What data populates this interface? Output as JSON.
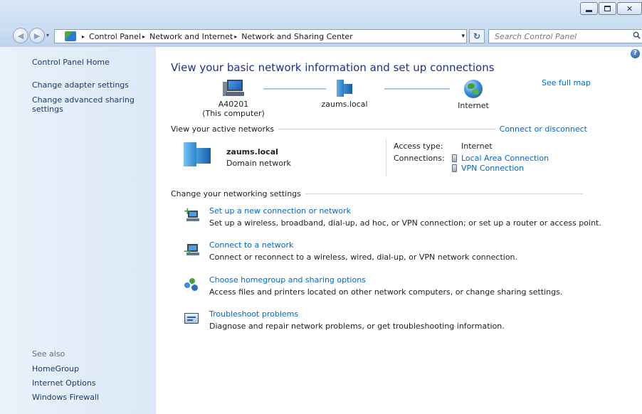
{
  "window": {
    "minimize_glyph": "",
    "close_glyph": "✕"
  },
  "address_bar": {
    "crumbs": [
      "Control Panel",
      "Network and Internet",
      "Network and Sharing Center"
    ],
    "arrow": "▸",
    "dropdown": "▾",
    "refresh": "↻"
  },
  "search": {
    "placeholder": "Search Control Panel"
  },
  "left_pane": {
    "home": "Control Panel Home",
    "adapter": "Change adapter settings",
    "advanced": "Change advanced sharing settings",
    "see_also_title": "See also",
    "see_also": [
      "HomeGroup",
      "Internet Options",
      "Windows Firewall"
    ]
  },
  "main": {
    "title": "View your basic network information and set up connections",
    "see_full_map": "See full map",
    "map": {
      "computer_name": "A40201",
      "computer_sub": "(This computer)",
      "domain": "zaums.local",
      "internet": "Internet"
    },
    "active_networks": {
      "header": "View your active networks",
      "connect_link": "Connect or disconnect",
      "name": "zaums.local",
      "type": "Domain network",
      "access_type_label": "Access type:",
      "access_type_value": "Internet",
      "connections_label": "Connections:",
      "connections": [
        "Local Area Connection",
        "VPN Connection"
      ]
    },
    "change_settings": {
      "header": "Change your networking settings",
      "tasks": [
        {
          "link": "Set up a new connection or network",
          "desc": "Set up a wireless, broadband, dial-up, ad hoc, or VPN connection; or set up a router or access point."
        },
        {
          "link": "Connect to a network",
          "desc": "Connect or reconnect to a wireless, wired, dial-up, or VPN network connection."
        },
        {
          "link": "Choose homegroup and sharing options",
          "desc": "Access files and printers located on other network computers, or change sharing settings."
        },
        {
          "link": "Troubleshoot problems",
          "desc": "Diagnose and repair network problems, or get troubleshooting information."
        }
      ]
    }
  },
  "help_glyph": "?"
}
